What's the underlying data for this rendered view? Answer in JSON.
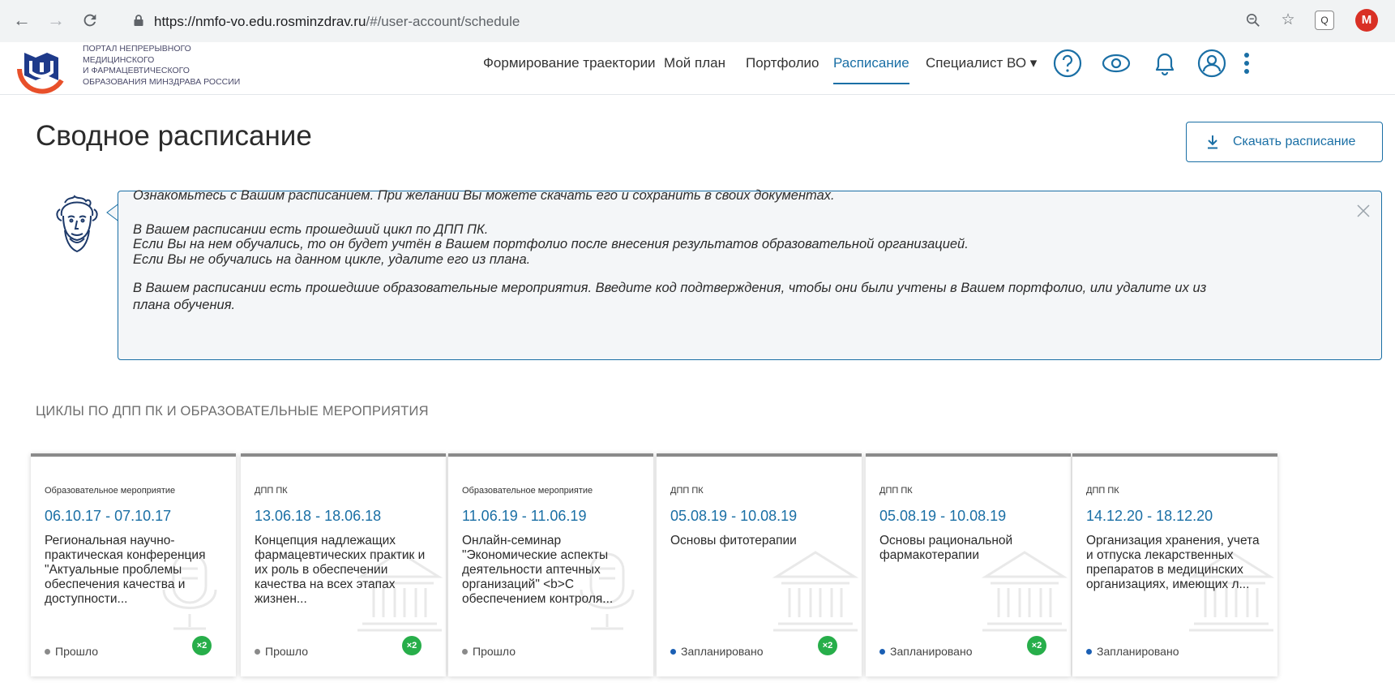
{
  "browser": {
    "url_host": "https://nmfo-vo.edu.rosminzdrav.ru",
    "url_path": "/#/user-account/schedule",
    "ext_label": "Q",
    "profile_initial": "M"
  },
  "logo": {
    "lines": [
      "ПОРТАЛ НЕПРЕРЫВНОГО",
      "МЕДИЦИНСКОГО",
      "И ФАРМАЦЕВТИЧЕСКОГО",
      "ОБРАЗОВАНИЯ МИНЗДРАВА РОССИИ"
    ]
  },
  "nav": {
    "items": [
      {
        "label": "Формирование траектории"
      },
      {
        "label": "Мой план"
      },
      {
        "label": "Портфолио"
      },
      {
        "label": "Расписание",
        "active": true
      },
      {
        "label": "Специалист ВО ▾"
      }
    ]
  },
  "page": {
    "title": "Сводное расписание",
    "download_label": "Скачать расписание"
  },
  "info": {
    "p1": "Ознакомьтесь с Вашим расписанием. При желании Вы можете скачать его и сохранить в своих документах.",
    "p2_l1": "В Вашем расписании есть прошедший цикл по ДПП ПК.",
    "p2_l2": "Если Вы на нем обучались, то он будет учтён в Вашем портфолио после внесения результатов образовательной организацией.",
    "p2_l3": "Если Вы не обучались на данном цикле, удалите его из плана.",
    "p3_l1": "В Вашем расписании есть прошедшие образовательные мероприятия. Введите код подтверждения, чтобы они были учтены в Вашем портфолио, или удалите их из",
    "p3_l2": "плана обучения."
  },
  "section": {
    "title": "ЦИКЛЫ ПО ДПП ПК И ОБРАЗОВАТЕЛЬНЫЕ МЕРОПРИЯТИЯ"
  },
  "cards": [
    {
      "type": "Образовательное мероприятие",
      "dates": "06.10.17 - 07.10.17",
      "title": "Региональная научно-практическая конференция \"Актуальные проблемы обеспечения качества и доступности...",
      "status": "Прошло",
      "status_color": "#8a8a8a",
      "badge": "×2",
      "watermark": "microphone"
    },
    {
      "type": "ДПП ПК",
      "dates": "13.06.18 - 18.06.18",
      "title": "Концепция надлежащих фармацевтических практик и их роль в обеспечении качества на всех этапах жизнен...",
      "status": "Прошло",
      "status_color": "#8a8a8a",
      "badge": "×2",
      "watermark": "building"
    },
    {
      "type": "Образовательное мероприятие",
      "dates": "11.06.19 - 11.06.19",
      "title": "Онлайн-семинар \"Экономические аспекты деятельности аптечных организаций\" <b>С обеспечением контроля...",
      "status": "Прошло",
      "status_color": "#8a8a8a",
      "badge": "",
      "watermark": "microphone"
    },
    {
      "type": "ДПП ПК",
      "dates": "05.08.19 - 10.08.19",
      "title": "Основы фитотерапии",
      "status": "Запланировано",
      "status_color": "#1a5fb4",
      "badge": "×2",
      "watermark": "building"
    },
    {
      "type": "ДПП ПК",
      "dates": "05.08.19 - 10.08.19",
      "title": "Основы рациональной фармакотерапии",
      "status": "Запланировано",
      "status_color": "#1a5fb4",
      "badge": "×2",
      "watermark": "building"
    },
    {
      "type": "ДПП ПК",
      "dates": "14.12.20 - 18.12.20",
      "title": "Организация хранения, учета и отпуска лекарственных препаратов в медицинских организациях, имеющих л...",
      "status": "Запланировано",
      "status_color": "#1a5fb4",
      "badge": "",
      "watermark": "building"
    }
  ]
}
